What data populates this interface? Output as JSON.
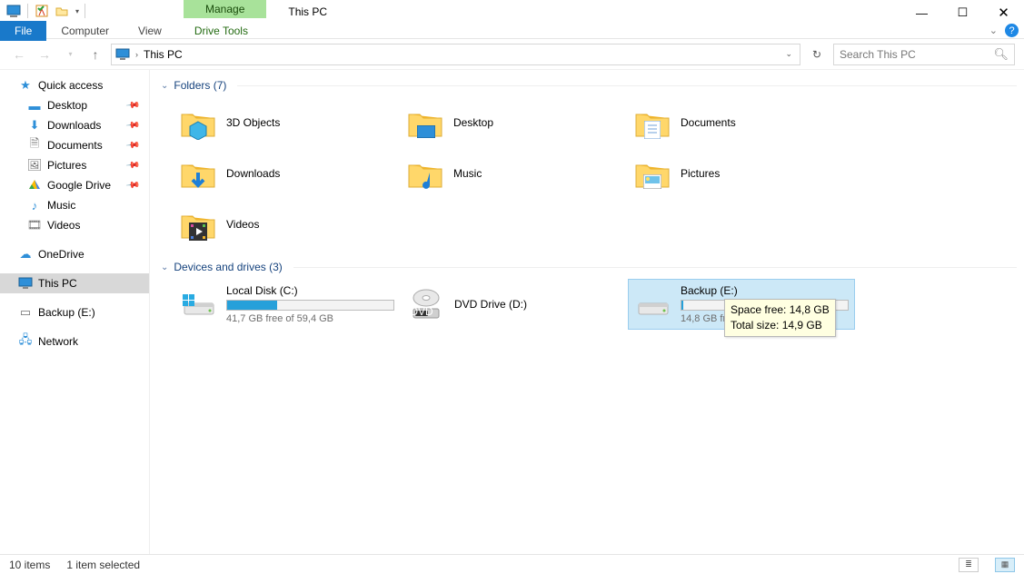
{
  "window": {
    "title": "This PC",
    "context_tab": {
      "header": "Manage",
      "tab": "Drive Tools"
    }
  },
  "ribbon": {
    "file": "File",
    "tabs": [
      "Computer",
      "View"
    ]
  },
  "nav": {
    "address": "This PC",
    "search_placeholder": "Search This PC"
  },
  "sidebar": {
    "quick_access": "Quick access",
    "items": [
      {
        "label": "Desktop",
        "pinned": true
      },
      {
        "label": "Downloads",
        "pinned": true
      },
      {
        "label": "Documents",
        "pinned": true
      },
      {
        "label": "Pictures",
        "pinned": true
      },
      {
        "label": "Google Drive",
        "pinned": true
      },
      {
        "label": "Music",
        "pinned": false
      },
      {
        "label": "Videos",
        "pinned": false
      }
    ],
    "onedrive": "OneDrive",
    "this_pc": "This PC",
    "backup": "Backup (E:)",
    "network": "Network"
  },
  "groups": {
    "folders": {
      "title": "Folders (7)",
      "items": [
        "3D Objects",
        "Desktop",
        "Documents",
        "Downloads",
        "Music",
        "Pictures",
        "Videos"
      ]
    },
    "drives": {
      "title": "Devices and drives (3)",
      "items": [
        {
          "name": "Local Disk (C:)",
          "sub": "41,7 GB free of 59,4 GB",
          "fill_pct": 30,
          "selected": false,
          "type": "hdd"
        },
        {
          "name": "DVD Drive (D:)",
          "sub": "",
          "fill_pct": null,
          "selected": false,
          "type": "dvd"
        },
        {
          "name": "Backup (E:)",
          "sub": "14,8 GB free",
          "fill_pct": 1,
          "selected": true,
          "type": "hdd"
        }
      ]
    }
  },
  "tooltip": {
    "line1": "Space free: 14,8 GB",
    "line2": "Total size: 14,9 GB"
  },
  "status": {
    "count": "10 items",
    "selection": "1 item selected"
  }
}
